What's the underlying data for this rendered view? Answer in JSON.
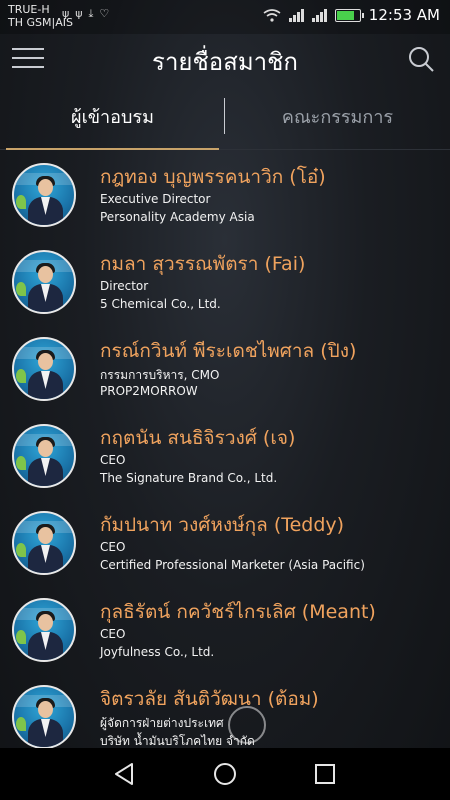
{
  "status_bar": {
    "carrier_line1": "TRUE-H",
    "carrier_line2": "TH GSM|AIS",
    "time": "12:53 AM",
    "notification_icons": [
      "usb-icon",
      "usb-icon",
      "download-icon",
      "heart-check-icon"
    ],
    "battery_color": "#49d04c"
  },
  "header": {
    "title": "รายชื่อสมาชิก",
    "menu_icon": "hamburger-menu-icon",
    "search_icon": "search-icon"
  },
  "tabs": [
    {
      "label": "ผู้เข้าอบรม",
      "active": true
    },
    {
      "label": "คณะกรรมการ",
      "active": false
    }
  ],
  "colors": {
    "name": "#f0a35e",
    "tab_underline": "#c8a36a",
    "inactive_tab": "#9aa0a8"
  },
  "members": [
    {
      "name": "กฎทอง บุญพรรคนาวิก (โอ๋)",
      "line1": "Executive Director",
      "line2": "Personality Academy Asia"
    },
    {
      "name": "กมลา สุวรรณพัตรา (Fai)",
      "line1": "Director",
      "line2": "5 Chemical Co., Ltd."
    },
    {
      "name": "กรณ์กวินท์ พีระเดชไพศาล (ปิง)",
      "line1": "กรรมการบริหาร, CMO",
      "line2": "PROP2MORROW"
    },
    {
      "name": "กฤตนัน สนธิจิรวงศ์ (เจ)",
      "line1": "CEO",
      "line2": "The Signature Brand Co., Ltd."
    },
    {
      "name": "กัมปนาท วงศ์หงษ์กุล (Teddy)",
      "line1": "CEO",
      "line2": "Certified Professional Marketer (Asia Pacific)"
    },
    {
      "name": "กุลธิรัตน์ กควัชร์ไกรเลิศ (Meant)",
      "line1": "CEO",
      "line2": "Joyfulness Co., Ltd."
    },
    {
      "name": "จิตรวลัย  สันติวัฒนา (ต้อม)",
      "line1": "ผู้จัดการฝ่ายต่างประเทศ",
      "line2": "บริษัท น้ำมันบริโภคไทย จำกัด"
    }
  ],
  "nav": {
    "back_icon": "back-triangle-icon",
    "home_icon": "home-circle-icon",
    "recents_icon": "recents-square-icon"
  }
}
